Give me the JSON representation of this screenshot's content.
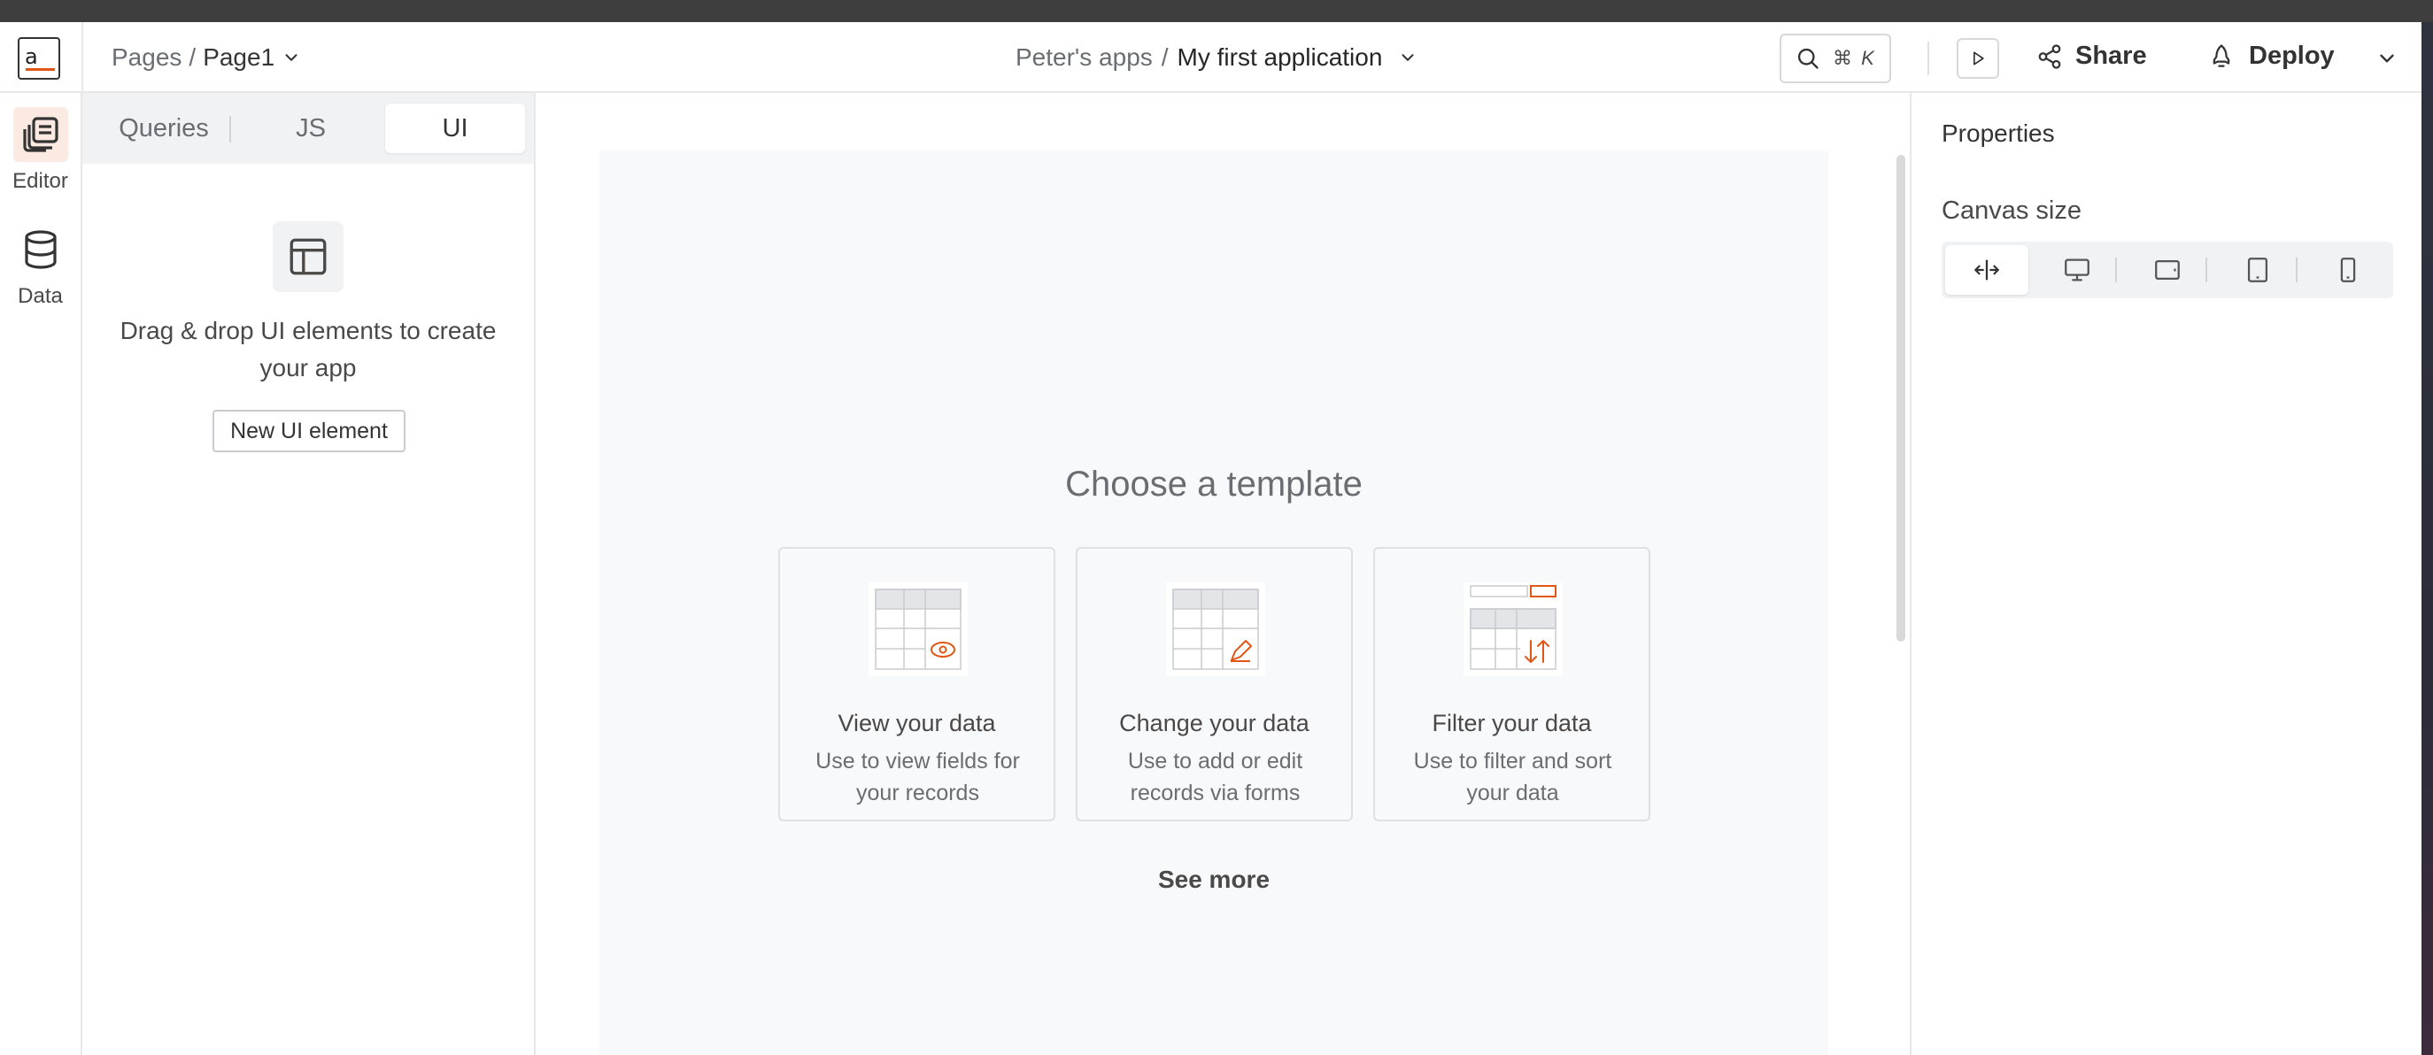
{
  "header": {
    "breadcrumb_root": "Pages",
    "breadcrumb_sep": "/",
    "breadcrumb_page": "Page1",
    "workspace": "Peter's apps",
    "workspace_sep": "/",
    "app_name": "My first application",
    "search_shortcut": "⌘ K",
    "share_label": "Share",
    "deploy_label": "Deploy"
  },
  "leftbar": {
    "items": [
      {
        "label": "Editor",
        "icon": "editor-pages-icon",
        "active": true
      },
      {
        "label": "Data",
        "icon": "database-icon",
        "active": false
      }
    ]
  },
  "sidepanel": {
    "tabs": [
      {
        "label": "Queries",
        "active": false
      },
      {
        "label": "JS",
        "active": false
      },
      {
        "label": "UI",
        "active": true
      }
    ],
    "placeholder_text": "Drag & drop UI elements to create your app",
    "new_element_label": "New UI element"
  },
  "canvas": {
    "title": "Choose a template",
    "templates": [
      {
        "title": "View your data",
        "description": "Use to view fields for your records",
        "icon": "table-view-icon"
      },
      {
        "title": "Change your data",
        "description": "Use to add or edit records via forms",
        "icon": "table-edit-icon"
      },
      {
        "title": "Filter your data",
        "description": "Use to filter and sort your data",
        "icon": "table-filter-icon"
      }
    ],
    "see_more": "See more"
  },
  "properties": {
    "title": "Properties",
    "canvas_size_label": "Canvas size",
    "canvas_sizes": [
      "fluid",
      "desktop",
      "tablet-landscape",
      "tablet",
      "mobile"
    ],
    "selected_size": "fluid"
  },
  "colors": {
    "accent": "#e15615",
    "accent_soft": "#fbeae2"
  }
}
